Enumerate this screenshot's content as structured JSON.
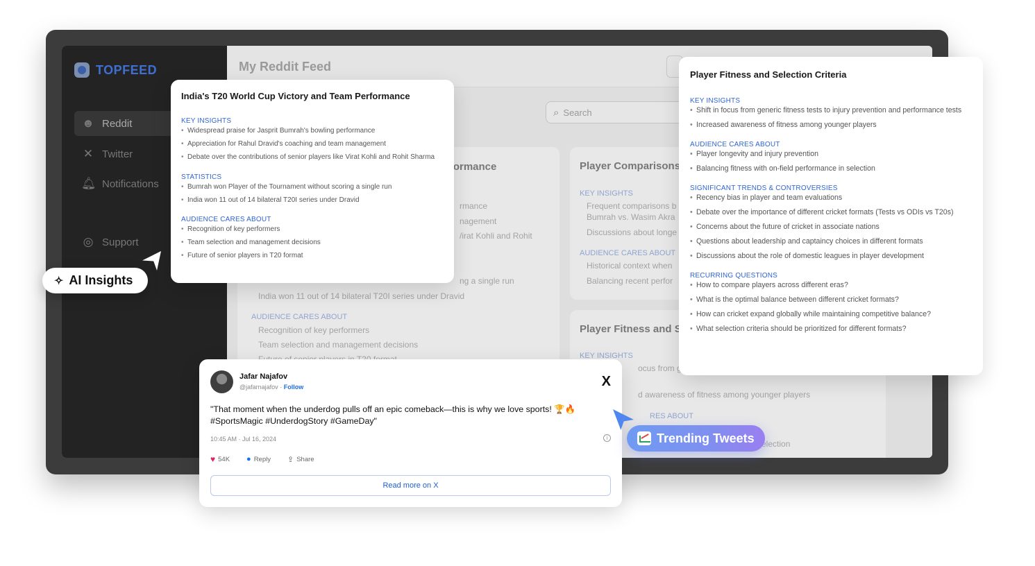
{
  "app": {
    "logo": "TOPFEED",
    "feed_title": "My Reddit Feed",
    "search_placeholder": "Search"
  },
  "sidebar": {
    "items": [
      {
        "label": "Reddit",
        "icon": "reddit-icon",
        "active": true
      },
      {
        "label": "Twitter",
        "icon": "x-icon"
      },
      {
        "label": "Notifications",
        "icon": "bell-icon"
      },
      {
        "label": "Support",
        "icon": "lifebuoy-icon"
      }
    ]
  },
  "background_cards": {
    "center_title_fragment": "rformance",
    "center_lines": [
      "rmance",
      "nagement",
      "/irat Kohli and Rohit",
      "ng a single run",
      "India won 11 out of 14 bilateral T20I series under Dravid"
    ],
    "center_section": "AUDIENCE CARES ABOUT",
    "center_section_lines": [
      "Recognition of key performers",
      "Team selection and management decisions",
      "Future of senior players in T20 format"
    ],
    "right_title": "Player Comparisons",
    "right_sections": [
      "KEY INSIGHTS",
      "AUDIENCE CARES ABOUT"
    ],
    "right_lines": [
      "Frequent comparisons b",
      "Bumrah vs. Wasim Akra",
      "Discussions about longe",
      "Historical context when",
      "Balancing recent perfor"
    ],
    "right2_title": "Player Fitness and Se",
    "right2_section": "KEY INSIGHTS",
    "right2_lines": [
      "ocus from gene",
      "d awareness of fitness among younger players",
      "RES ABOUT",
      "selection"
    ]
  },
  "insight_card_india": {
    "title": "India's T20 World Cup Victory and Team Performance",
    "sections": [
      {
        "heading": "KEY INSIGHTS",
        "items": [
          "Widespread praise for Jasprit Bumrah's bowling performance",
          "Appreciation for Rahul Dravid's coaching and team management",
          "Debate over the contributions of senior players like Virat Kohli and Rohit Sharma"
        ]
      },
      {
        "heading": "STATISTICS",
        "items": [
          "Bumrah won Player of the Tournament without scoring a single run",
          "India won 11 out of 14 bilateral T20I series under Dravid"
        ]
      },
      {
        "heading": "AUDIENCE CARES ABOUT",
        "items": [
          "Recognition of key performers",
          "Team selection and management decisions",
          "Future of senior players in T20 format"
        ]
      }
    ]
  },
  "insight_card_fitness": {
    "title": "Player Fitness and Selection Criteria",
    "sections": [
      {
        "heading": "KEY INSIGHTS",
        "items": [
          "Shift in focus from generic fitness tests to injury prevention and performance tests",
          "Increased awareness of fitness among younger players"
        ]
      },
      {
        "heading": "AUDIENCE CARES ABOUT",
        "items": [
          "Player longevity and injury prevention",
          "Balancing fitness with on-field performance in selection"
        ]
      },
      {
        "heading": "SIGNIFICANT TRENDS & CONTROVERSIES",
        "items": [
          "Recency bias in player and team evaluations",
          "Debate over the importance of different cricket formats (Tests vs ODIs vs T20s)",
          "Concerns about the future of cricket in associate nations",
          "Questions about leadership and captaincy choices in different formats",
          "Discussions about the role of domestic leagues in player development"
        ]
      },
      {
        "heading": "RECURRING QUESTIONS",
        "items": [
          "How to compare players across different eras?",
          "What is the optimal balance between different cricket formats?",
          "How can cricket expand globally while maintaining competitive balance?",
          "What selection criteria should be prioritized for different formats?"
        ]
      }
    ]
  },
  "tweet": {
    "name": "Jafar Najafov",
    "handle": "@jafarnajafov",
    "separator": "·",
    "follow": "Follow",
    "text_line1": "\"That moment when the underdog pulls off an epic comeback—this is why we love sports! 🏆🔥",
    "text_line2": "#SportsMagic #UnderdogStory #GameDay\"",
    "time": "10:45 AM · Jul 16, 2024",
    "likes": "54K",
    "reply": "Reply",
    "share": "Share",
    "read_more": "Read more on X",
    "info": "i",
    "x_glyph": "X"
  },
  "pills": {
    "ai_insights": "AI Insights",
    "trending_tweets": "Trending Tweets"
  },
  "glyphs": {
    "sparkle": "✧",
    "reddit": "☻",
    "x": "✕",
    "bell": "🔔︎",
    "support": "◎",
    "search": "⌕",
    "heart": "♥",
    "bubble": "●",
    "share": "⇪"
  },
  "colors": {
    "accent": "#2f64d6",
    "trend_gradient_start": "#6f9bf2",
    "trend_gradient_end": "#9a7ff0",
    "like": "#e0245e"
  }
}
